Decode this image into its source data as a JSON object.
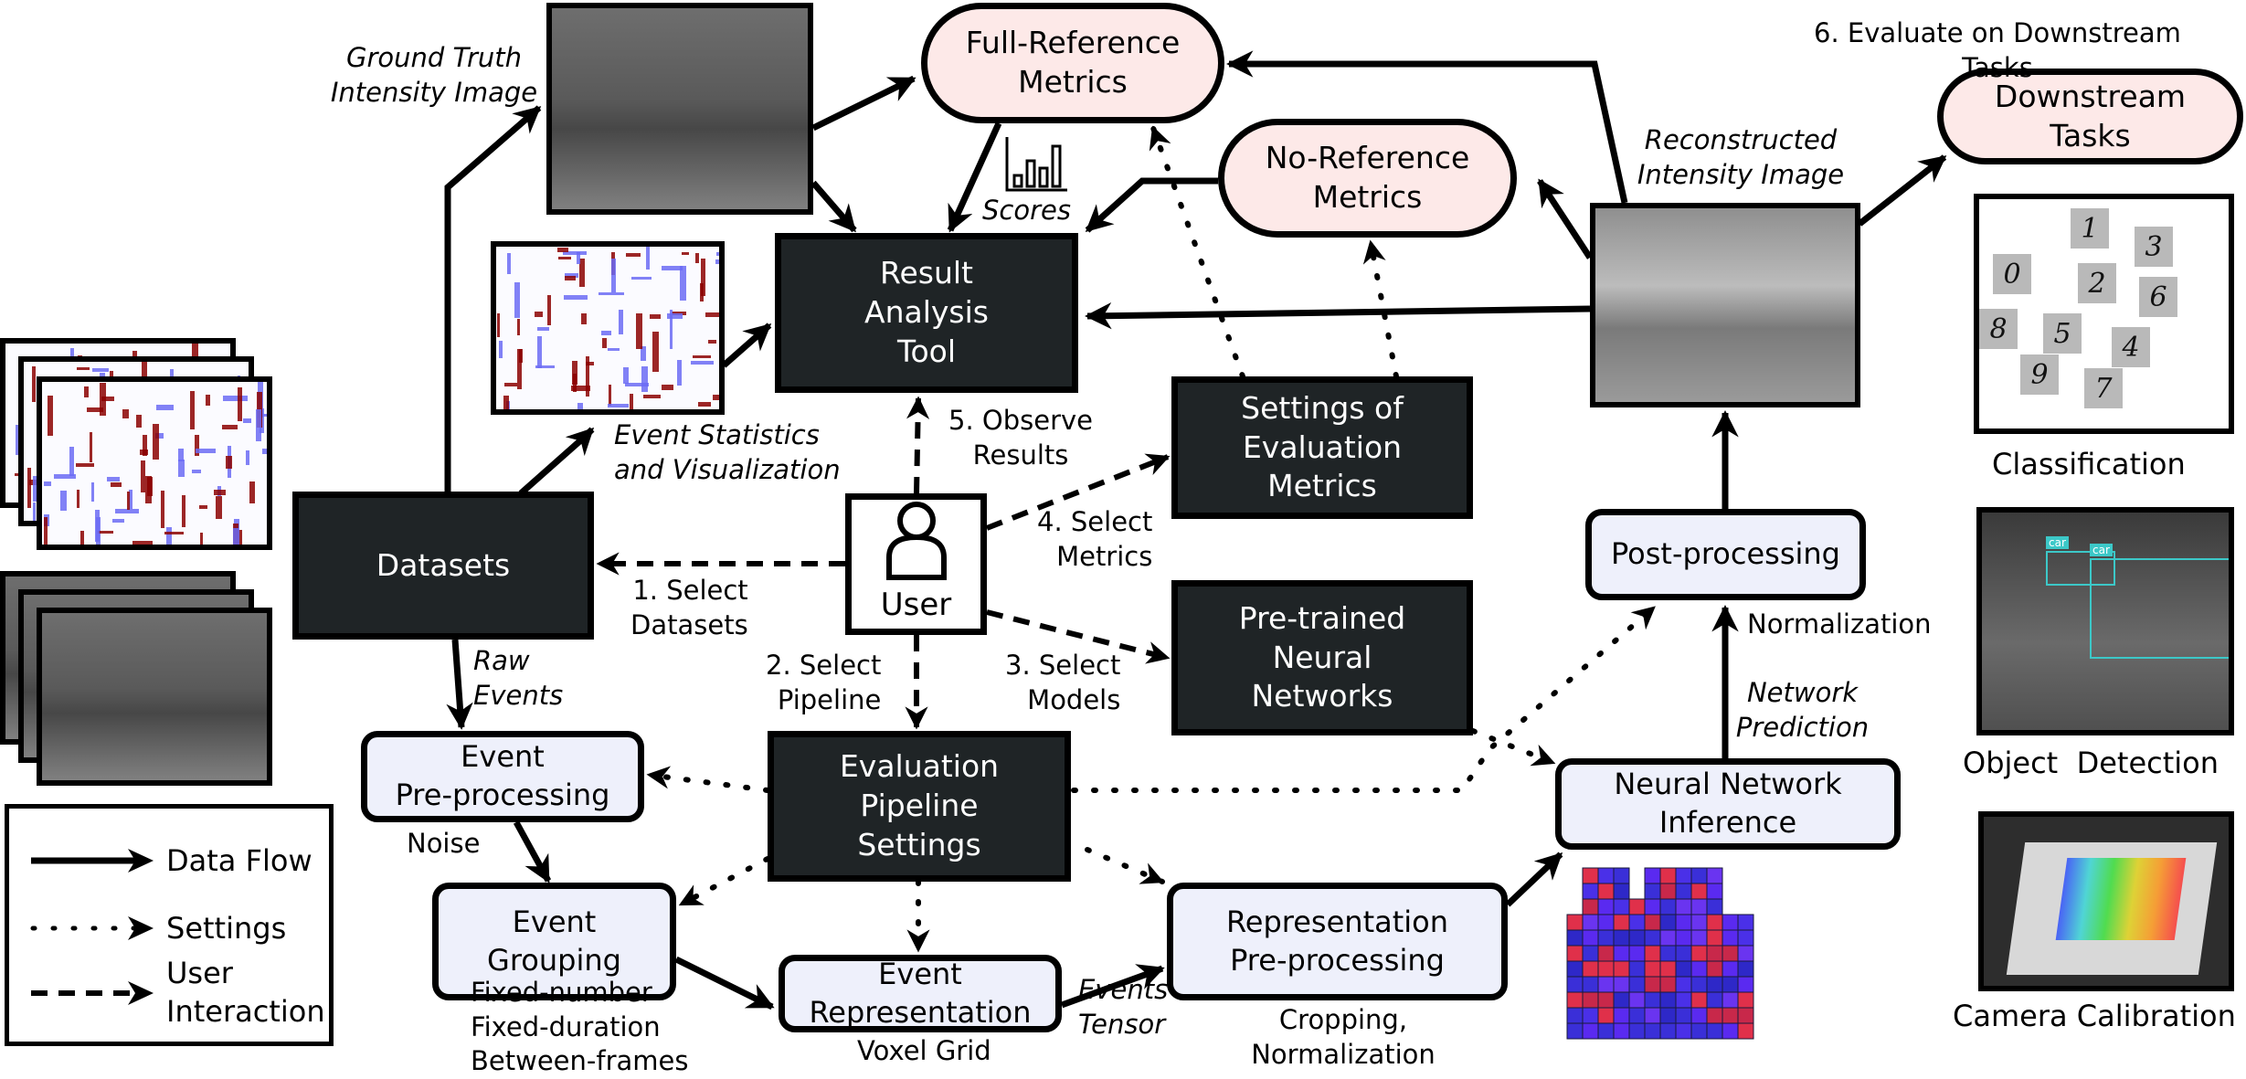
{
  "nodes": {
    "full_reference": "Full-Reference\nMetrics",
    "no_reference": "No-Reference\nMetrics",
    "downstream": "Downstream\nTasks",
    "result_tool": "Result\nAnalysis\nTool",
    "datasets": "Datasets",
    "user": "User",
    "settings_metrics": "Settings of\nEvaluation\nMetrics",
    "pretrained_nn": "Pre-trained\nNeural\nNetworks",
    "post_processing": "Post-processing",
    "pipeline_settings": "Evaluation\nPipeline\nSettings",
    "event_preprocessing": "Event\nPre-processing",
    "event_grouping": "Event\nGrouping",
    "event_representation": "Event\nRepresentation",
    "repr_preprocessing": "Representation\nPre-processing",
    "nn_inference": "Neural Network\nInference"
  },
  "labels": {
    "ground_truth": "Ground Truth\nIntensity Image",
    "event_stats": "Event Statistics\nand Visualization",
    "scores": "Scores",
    "reconstructed": "Reconstructed\nIntensity Image",
    "evaluate_downstream": "6. Evaluate on Downstream\nTasks",
    "observe_results": "5. Observe\nResults",
    "select_metrics": "4. Select\nMetrics",
    "select_datasets": "1. Select\nDatasets",
    "select_pipeline": "2. Select\nPipeline",
    "select_models": "3. Select\nModels",
    "raw_events": "Raw\nEvents",
    "noise": "Noise",
    "grouping_options": "Fixed-number\nFixed-duration\nBetween-frames",
    "voxel_grid": "Voxel Grid",
    "events_tensor": "Events\nTensor",
    "cropping_norm": "Cropping,\nNormalization",
    "normalization": "Normalization",
    "network_prediction": "Network\nPrediction",
    "classification": "Classification",
    "object_detection": "Object  Detection",
    "camera_calibration": "Camera Calibration"
  },
  "legend": {
    "data_flow": "Data Flow",
    "settings": "Settings",
    "user_interaction": "User\nInteraction"
  },
  "digits": [
    "1",
    "3",
    "0",
    "2",
    "6",
    "8",
    "5",
    "4",
    "9",
    "7"
  ],
  "detection_tags": [
    "car",
    "car"
  ],
  "colors": {
    "dark_box": "#1f2426",
    "light_box": "#eef0fb",
    "metric_box": "#fde9e8",
    "event_positive": "#6b6bf5",
    "event_negative": "#8b0000",
    "detection_box": "#3cc8c8"
  }
}
